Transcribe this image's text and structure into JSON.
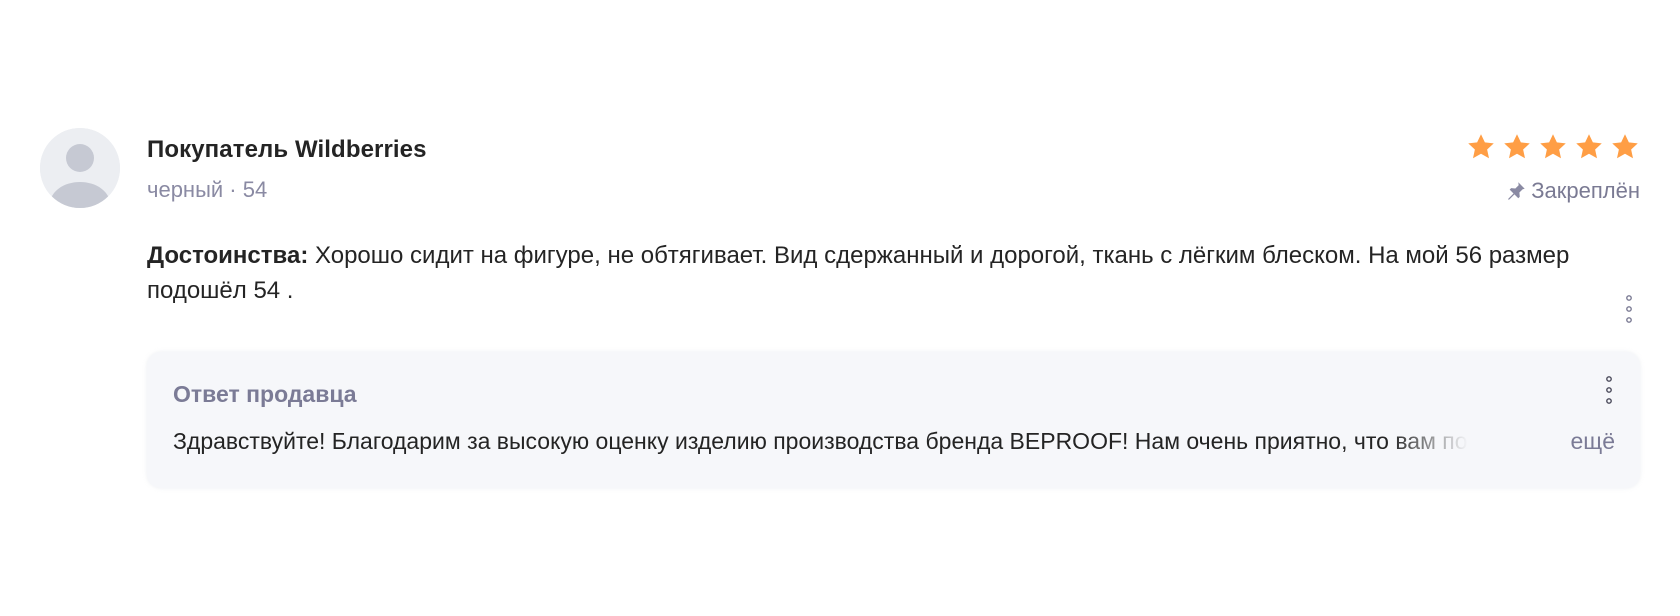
{
  "review": {
    "author": "Покупатель Wildberries",
    "variant": "черный · 54",
    "rating": 5,
    "rating_max": 5,
    "star_color": "#ff9e45",
    "pinned_label": "Закреплён",
    "pros_label": "Достоинства:",
    "pros_text": " Хорошо сидит на фигуре, не обтягивает. Вид сдержанный и дорогой, ткань с лёгким блеском. На мой 56 размер подошёл 54 .",
    "menu_icon": "more-vertical-icon"
  },
  "seller_reply": {
    "title": "Ответ продавца",
    "text": "Здравствуйте! Благодарим за высокую оценку изделию производства бренда BEPROOF! Нам очень приятно, что вам понравилось",
    "more_label": "ещё",
    "menu_icon": "more-vertical-icon"
  },
  "icons": {
    "avatar": "user-placeholder-icon",
    "star": "star-icon",
    "pin": "pin-icon"
  }
}
